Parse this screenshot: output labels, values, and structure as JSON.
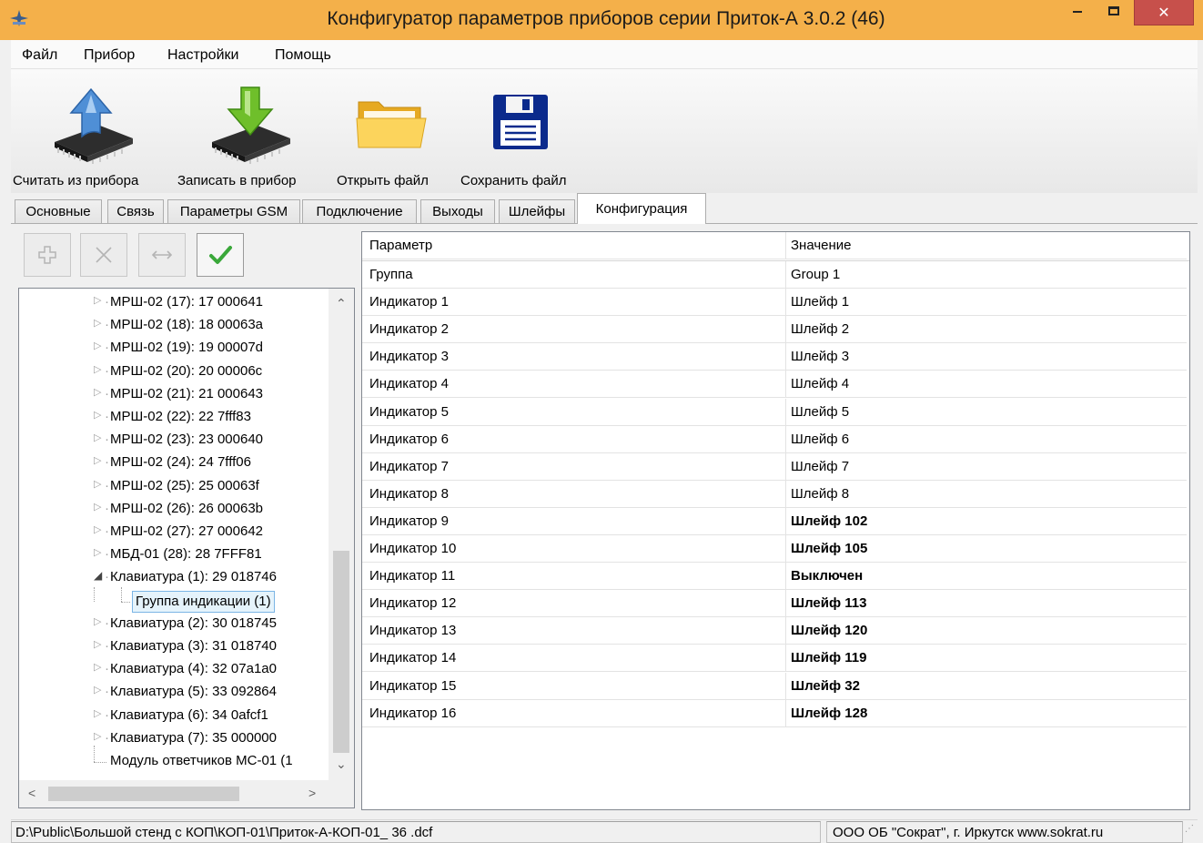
{
  "window": {
    "title": "Конфигуратор параметров приборов серии Приток-А   3.0.2 (46)",
    "minimize_icon": "minimize-icon",
    "maximize_icon": "maximize-icon",
    "close_icon": "close-icon",
    "close_glyph": "✕"
  },
  "menu": {
    "items": [
      "Файл",
      "Прибор",
      "Настройки",
      "Помощь"
    ]
  },
  "toolbar": {
    "read_label": "Считать из прибора",
    "write_label": "Записать в прибор",
    "open_label": "Открыть файл",
    "save_label": "Сохранить файл"
  },
  "tabs": [
    "Основные",
    "Связь",
    "Параметры GSM",
    "Подключение",
    "Выходы",
    "Шлейфы",
    "Конфигурация"
  ],
  "active_tab": "Конфигурация",
  "edit_buttons": {
    "add_icon": "plus-icon",
    "delete_icon": "cross-icon",
    "move_icon": "arrows-icon",
    "apply_icon": "checkmark-icon"
  },
  "tree": {
    "items": [
      "МРШ-02 (17): 17 000641",
      "МРШ-02 (18): 18 00063a",
      "МРШ-02 (19): 19 00007d",
      "МРШ-02 (20): 20 00006c",
      "МРШ-02 (21): 21 000643",
      "МРШ-02 (22): 22 7fff83",
      "МРШ-02 (23): 23 000640",
      "МРШ-02 (24): 24 7fff06",
      "МРШ-02 (25): 25 00063f",
      "МРШ-02 (26): 26 00063b",
      "МРШ-02 (27): 27 000642",
      "МБД-01 (28): 28 7FFF81",
      "Клавиатура (1): 29 018746",
      "Группа индикации (1)",
      "Клавиатура (2): 30 018745",
      "Клавиатура (3): 31 018740",
      "Клавиатура (4): 32 07a1a0",
      "Клавиатура (5): 33 092864",
      "Клавиатура (6): 34 0afcf1",
      "Клавиатура (7): 35 000000",
      "Модуль ответчиков МС-01 (1"
    ],
    "expanded_item": "Клавиатура (1): 29 018746",
    "selected_item": "Группа индикации (1)"
  },
  "grid": {
    "columns": [
      "Параметр",
      "Значение"
    ],
    "rows": [
      {
        "param": "Группа",
        "value": "Group 1",
        "bold": false
      },
      {
        "param": "Индикатор 1",
        "value": "Шлейф 1",
        "bold": false
      },
      {
        "param": "Индикатор 2",
        "value": "Шлейф 2",
        "bold": false
      },
      {
        "param": "Индикатор 3",
        "value": "Шлейф 3",
        "bold": false
      },
      {
        "param": "Индикатор 4",
        "value": "Шлейф 4",
        "bold": false
      },
      {
        "param": "Индикатор 5",
        "value": "Шлейф 5",
        "bold": false
      },
      {
        "param": "Индикатор 6",
        "value": "Шлейф 6",
        "bold": false
      },
      {
        "param": "Индикатор 7",
        "value": "Шлейф 7",
        "bold": false
      },
      {
        "param": "Индикатор 8",
        "value": "Шлейф 8",
        "bold": false
      },
      {
        "param": "Индикатор 9",
        "value": "Шлейф 102",
        "bold": true
      },
      {
        "param": "Индикатор 10",
        "value": "Шлейф 105",
        "bold": true
      },
      {
        "param": "Индикатор 11",
        "value": "Выключен",
        "bold": true
      },
      {
        "param": "Индикатор 12",
        "value": "Шлейф 113",
        "bold": true
      },
      {
        "param": "Индикатор 13",
        "value": "Шлейф 120",
        "bold": true
      },
      {
        "param": "Индикатор 14",
        "value": "Шлейф 119",
        "bold": true
      },
      {
        "param": "Индикатор 15",
        "value": "Шлейф 32",
        "bold": true
      },
      {
        "param": "Индикатор 16",
        "value": "Шлейф 128",
        "bold": true
      }
    ]
  },
  "status": {
    "path": "D:\\Public\\Большой стенд с КОП\\КОП-01\\Приток-А-КОП-01_ 36 .dcf",
    "company": "ООО ОБ \"Сократ\", г. Иркутск   www.sokrat.ru"
  },
  "colors": {
    "titlebar": "#f4b04a",
    "close_button": "#c7504b",
    "selection_border": "#7bb5e5"
  }
}
